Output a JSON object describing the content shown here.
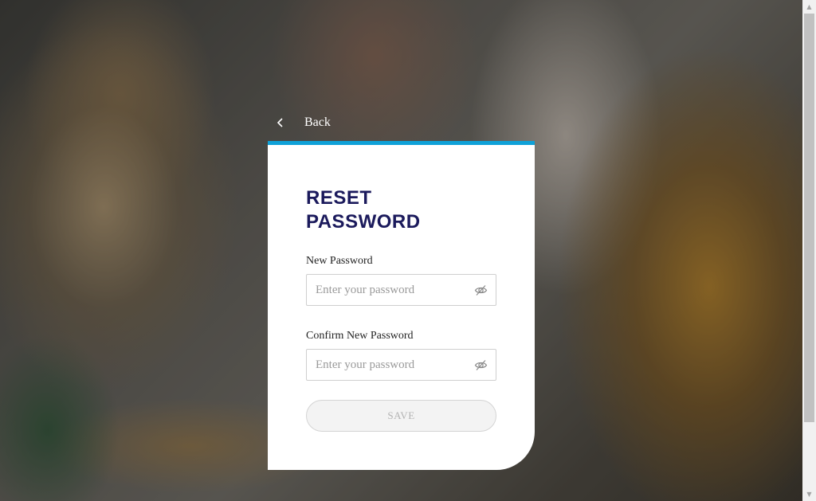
{
  "nav": {
    "back_label": "Back"
  },
  "card": {
    "title_line1": "RESET",
    "title_line2": "PASSWORD",
    "accent_color": "#0fa1d8",
    "title_color": "#1b1a5c"
  },
  "fields": {
    "new_password": {
      "label": "New Password",
      "value": "",
      "placeholder": "Enter your password",
      "toggle_icon": "eye-off-icon"
    },
    "confirm_password": {
      "label": "Confirm New Password",
      "value": "",
      "placeholder": "Enter your password",
      "toggle_icon": "eye-off-icon"
    }
  },
  "actions": {
    "save_label": "SAVE",
    "save_enabled": false
  },
  "icons": {
    "back": "chevron-left-icon",
    "scroll_up": "triangle-up-icon",
    "scroll_down": "triangle-down-icon"
  }
}
